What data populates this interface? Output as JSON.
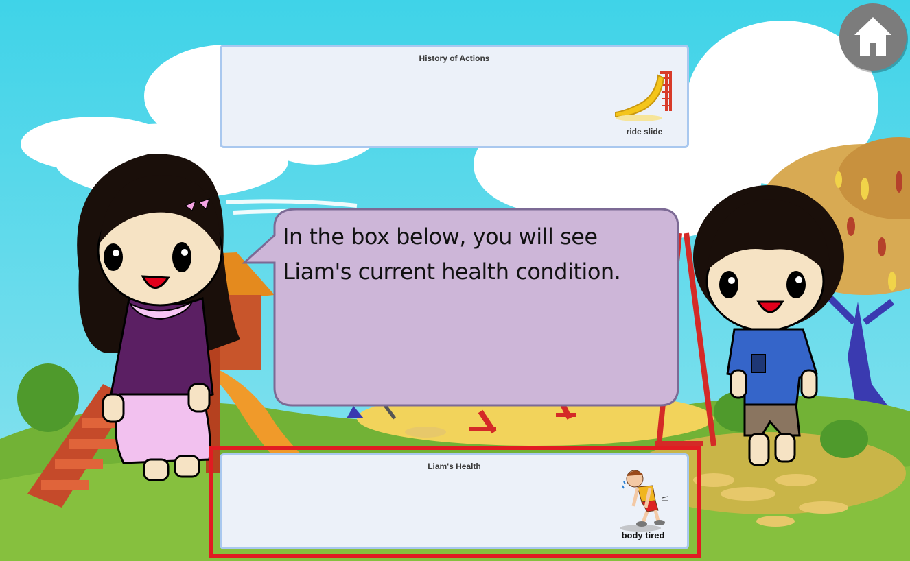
{
  "dialog": {
    "text": "In the box below, you will see Liam's current health condition."
  },
  "history_panel": {
    "title": "History of Actions",
    "items": [
      {
        "label": "ride slide",
        "icon": "slide-icon"
      }
    ]
  },
  "health_panel": {
    "title": "Liam's Health",
    "items": [
      {
        "label": "body tired",
        "icon": "tired-boy-icon"
      }
    ]
  },
  "home_button": {
    "icon": "home-icon"
  },
  "colors": {
    "sky": "#5fd0e6",
    "grass": "#7fb534",
    "speech_bubble": "#cdb6d8",
    "panel_bg": "#ecf1f9",
    "panel_border": "#a9c8ef",
    "highlight": "#e11b22",
    "home_button": "#7c7c7c"
  }
}
